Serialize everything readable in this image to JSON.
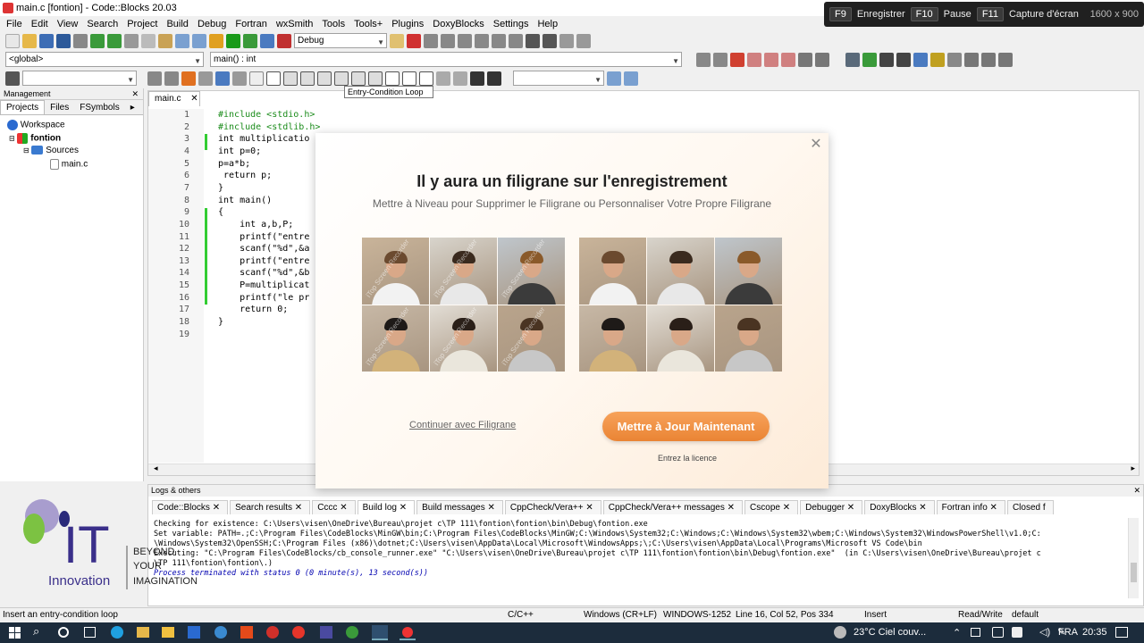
{
  "window": {
    "title": "main.c [fontion] - Code::Blocks 20.03"
  },
  "recorder_bar": {
    "keys": [
      {
        "key": "F9",
        "label": "Enregistrer"
      },
      {
        "key": "F10",
        "label": "Pause"
      },
      {
        "key": "F11",
        "label": "Capture d'écran"
      }
    ],
    "size": "1600 x 900"
  },
  "menu": [
    "File",
    "Edit",
    "View",
    "Search",
    "Project",
    "Build",
    "Debug",
    "Fortran",
    "wxSmith",
    "Tools",
    "Tools+",
    "Plugins",
    "DoxyBlocks",
    "Settings",
    "Help"
  ],
  "toolbar": {
    "build_target": "Debug",
    "scope": "<global>",
    "function": "main() : int",
    "tooltip": "Entry-Condition Loop"
  },
  "management": {
    "title": "Management",
    "tabs": [
      "Projects",
      "Files",
      "FSymbols"
    ],
    "tree": {
      "workspace": "Workspace",
      "project": "fontion",
      "folder": "Sources",
      "file": "main.c"
    }
  },
  "editor": {
    "tab": "main.c",
    "line_numbers": [
      "1",
      "2",
      "3",
      "4",
      "5",
      "6",
      "7",
      "8",
      "9",
      "10",
      "11",
      "12",
      "13",
      "14",
      "15",
      "16",
      "17",
      "18",
      "19"
    ],
    "lines": [
      "#include <stdio.h>",
      "#include <stdlib.h>",
      "int multiplicatio",
      "int p=0;",
      "p=a*b;",
      " return p;",
      "}",
      "int main()",
      "{",
      "    int a,b,P;",
      "    printf(\"entre",
      "    scanf(\"%d\",&a",
      "    printf(\"entre",
      "    scanf(\"%d\",&b",
      "    P=multiplicat",
      "    printf(\"le pr",
      "    return 0;",
      "}",
      ""
    ]
  },
  "modal": {
    "title": "Il y aura un filigrane sur l'enregistrement",
    "subtitle": "Mettre à Niveau pour Supprimer le Filigrane ou Personnaliser Votre Propre Filigrane",
    "watermark_text": "iTop Screen Recorder",
    "continue_link": "Continuer avec Filigrane",
    "upgrade_button": "Mettre à Jour Maintenant",
    "licence_link": "Entrez la licence"
  },
  "logs": {
    "title": "Logs & others",
    "tabs": [
      "Code::Blocks",
      "Search results",
      "Cccc",
      "Build log",
      "Build messages",
      "CppCheck/Vera++",
      "CppCheck/Vera++ messages",
      "Cscope",
      "Debugger",
      "DoxyBlocks",
      "Fortran info",
      "Closed f"
    ],
    "lines": [
      "Checking for existence: C:\\Users\\visen\\OneDrive\\Bureau\\projet c\\TP 111\\fontion\\fontion\\bin\\Debug\\fontion.exe",
      "Set variable: PATH=.;C:\\Program Files\\CodeBlocks\\MinGW\\bin;C:\\Program Files\\CodeBlocks\\MinGW;C:\\Windows\\System32;C:\\Windows;C:\\Windows\\System32\\wbem;C:\\Windows\\System32\\WindowsPowerShell\\v1.0;C:",
      "\\Windows\\System32\\OpenSSH;C:\\Program Files (x86)\\dotnet;C:\\Users\\visen\\AppData\\Local\\Microsoft\\WindowsApps;\\;C:\\Users\\visen\\AppData\\Local\\Programs\\Microsoft VS Code\\bin",
      "Executing: \"C:\\Program Files\\CodeBlocks/cb_console_runner.exe\" \"C:\\Users\\visen\\OneDrive\\Bureau\\projet c\\TP 111\\fontion\\fontion\\bin\\Debug\\fontion.exe\"  (in C:\\Users\\visen\\OneDrive\\Bureau\\projet c",
      "\\TP 111\\fontion\\fontion\\.)",
      "Process terminated with status 0 (0 minute(s), 13 second(s))"
    ]
  },
  "logo": {
    "it": "IT",
    "innovation": "Innovation",
    "tagline": [
      "BEYOND",
      "YOUR",
      "IMAGINATION"
    ]
  },
  "status": {
    "hint": "Insert an entry-condition loop",
    "lang": "C/C++",
    "eol": "Windows (CR+LF)",
    "encoding": "WINDOWS-1252",
    "position": "Line 16, Col 52, Pos 334",
    "mode": "Insert",
    "access": "Read/Write",
    "profile": "default"
  },
  "taskbar": {
    "weather": "23°C Ciel couv...",
    "lang": "FRA",
    "time": "20:35"
  }
}
